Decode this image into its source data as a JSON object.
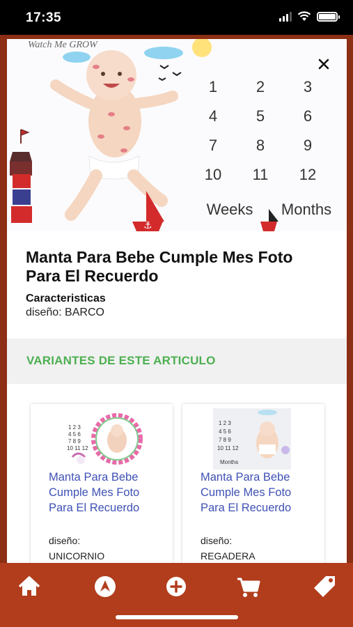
{
  "status_bar": {
    "time": "17:35"
  },
  "product": {
    "image_overlay": {
      "brand": "Watch Me GROW",
      "numbers": [
        "1",
        "2",
        "3",
        "4",
        "5",
        "6",
        "7",
        "8",
        "9",
        "10",
        "11",
        "12"
      ],
      "weeks_label": "Weeks",
      "months_label": "Months"
    },
    "title": "Manta Para Bebe Cumple Mes Foto Para El Recuerdo",
    "features_heading": "Caracteristicas",
    "features_value": "diseño: BARCO"
  },
  "variants": {
    "heading": "VARIANTES DE ESTE ARTICULO",
    "items": [
      {
        "name": "Manta Para Bebe Cumple Mes Foto Para El Recuerdo",
        "attr_label": "diseño:",
        "attr_value": "UNICORNIO"
      },
      {
        "name": "Manta Para Bebe Cumple Mes Foto Para El Recuerdo",
        "attr_label": "diseño:",
        "attr_value": "REGADERA"
      }
    ]
  },
  "colors": {
    "nav_bg": "#b13d1c",
    "accent_green": "#4caf50",
    "link_blue": "#3f51b5"
  },
  "nav": [
    "home-icon",
    "compass-icon",
    "add-icon",
    "cart-icon",
    "tag-icon"
  ]
}
